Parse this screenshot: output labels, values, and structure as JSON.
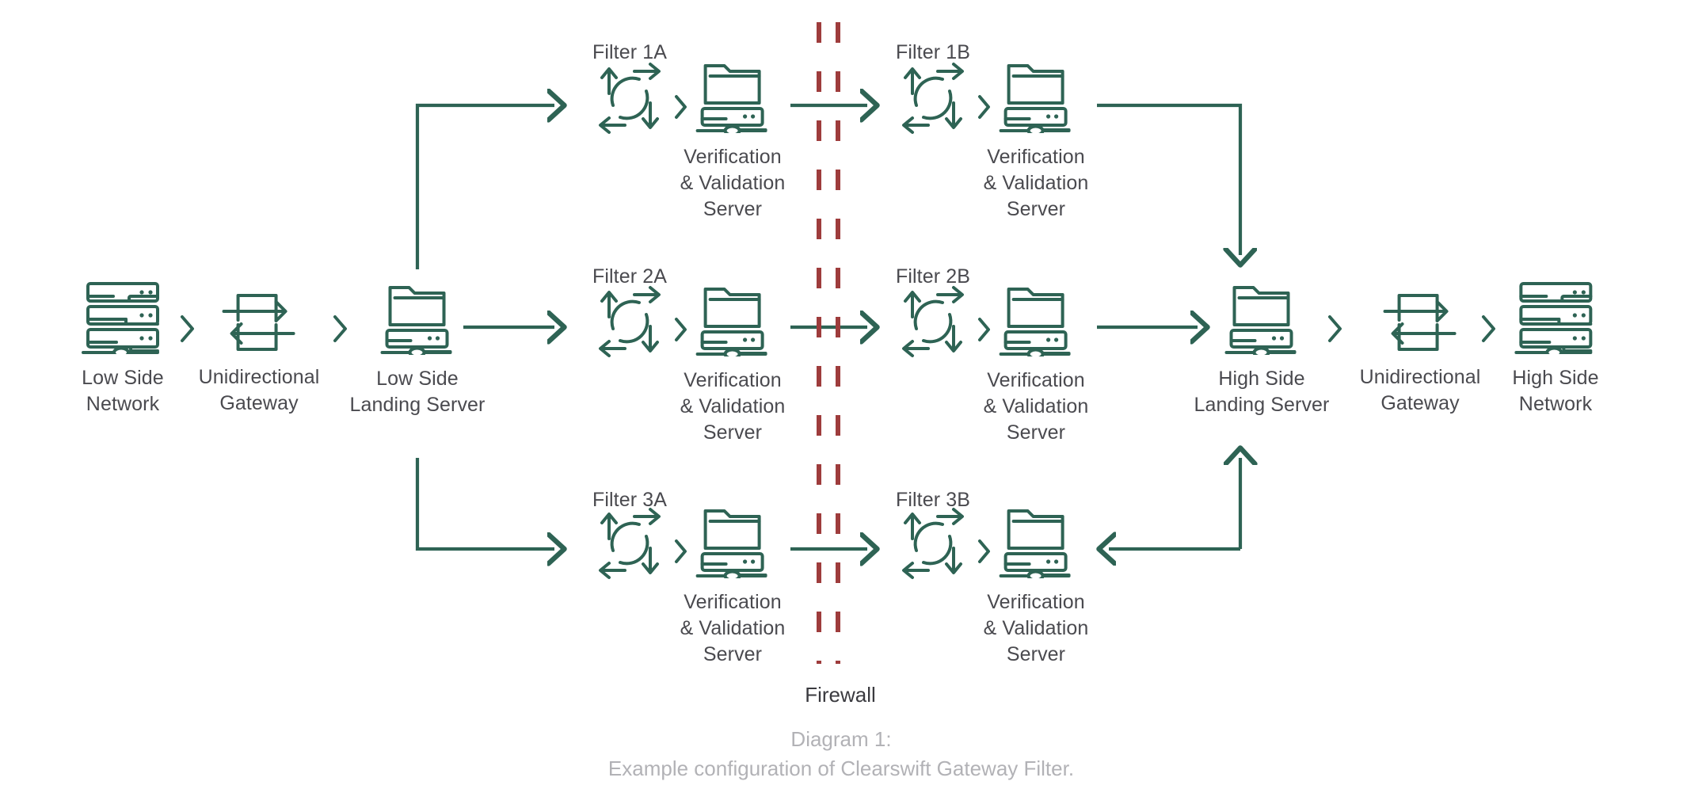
{
  "theme": {
    "line_color": "#2e6354",
    "icon_color": "#2e6354",
    "label_color": "#4a4a4f",
    "firewall_color": "#9e3c3c",
    "caption_color": "#b2b2b6",
    "background": "#ffffff"
  },
  "nodes": {
    "low_side_network": {
      "label": "Low Side\nNetwork",
      "icon": "network-rack-icon"
    },
    "low_gateway": {
      "label": "Unidirectional\nGateway",
      "icon": "unidirectional-gateway-icon"
    },
    "low_landing_server": {
      "label": "Low Side\nLanding Server",
      "icon": "folder-server-icon"
    },
    "high_landing_server": {
      "label": "High Side\nLanding Server",
      "icon": "folder-server-icon"
    },
    "high_gateway": {
      "label": "Unidirectional\nGateway",
      "icon": "unidirectional-gateway-icon"
    },
    "high_side_network": {
      "label": "High Side\nNetwork",
      "icon": "network-rack-icon"
    }
  },
  "vv_server_label": "Verification\n& Validation\nServer",
  "filters": [
    {
      "id": "filter-1a",
      "title": "Filter 1A",
      "row": 1,
      "side": "low",
      "icon": "cycle-filter-icon"
    },
    {
      "id": "filter-1b",
      "title": "Filter 1B",
      "row": 1,
      "side": "high",
      "icon": "cycle-filter-icon"
    },
    {
      "id": "filter-2a",
      "title": "Filter 2A",
      "row": 2,
      "side": "low",
      "icon": "cycle-filter-icon"
    },
    {
      "id": "filter-2b",
      "title": "Filter 2B",
      "row": 2,
      "side": "high",
      "icon": "cycle-filter-icon"
    },
    {
      "id": "filter-3a",
      "title": "Filter 3A",
      "row": 3,
      "side": "low",
      "icon": "cycle-filter-icon"
    },
    {
      "id": "filter-3b",
      "title": "Filter 3B",
      "row": 3,
      "side": "high",
      "icon": "cycle-filter-icon"
    }
  ],
  "firewall": {
    "label": "Firewall",
    "icon": "firewall-dashed-lines-icon"
  },
  "caption": "Diagram 1:\nExample configuration of Clearswift Gateway Filter."
}
